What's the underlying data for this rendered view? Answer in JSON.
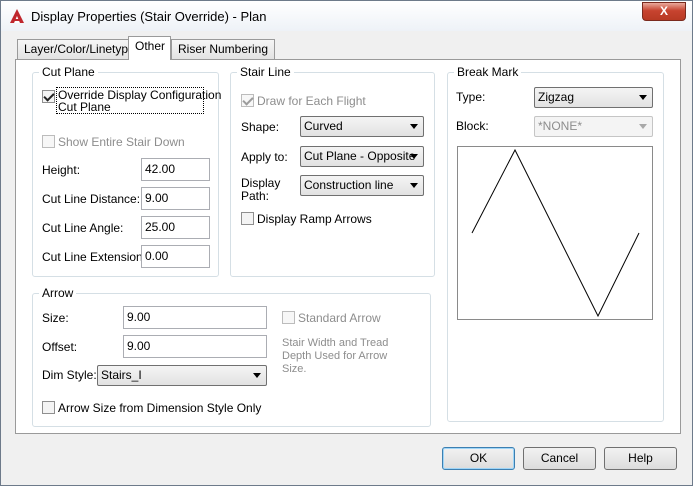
{
  "window": {
    "title": "Display Properties (Stair Override) - Plan",
    "close_glyph": "X"
  },
  "tabs": [
    {
      "label": "Layer/Color/Linetype"
    },
    {
      "label": "Other"
    },
    {
      "label": "Riser Numbering"
    }
  ],
  "cut_plane": {
    "title": "Cut Plane",
    "override_label_line1": "Override Display Configuration",
    "override_label_line2": "Cut Plane",
    "override_checked": true,
    "show_entire_label": "Show Entire Stair Down",
    "height_label": "Height:",
    "height_value": "42.00",
    "cut_line_distance_label": "Cut Line Distance:",
    "cut_line_distance_value": "9.00",
    "cut_line_angle_label": "Cut Line Angle:",
    "cut_line_angle_value": "25.00",
    "cut_line_extension_label": "Cut Line Extension:",
    "cut_line_extension_value": "0.00"
  },
  "stair_line": {
    "title": "Stair Line",
    "draw_each_flight_label": "Draw for Each Flight",
    "shape_label": "Shape:",
    "shape_value": "Curved",
    "apply_to_label": "Apply to:",
    "apply_to_value": "Cut Plane - Opposite",
    "display_path_label_line1": "Display",
    "display_path_label_line2": "Path:",
    "display_path_value": "Construction line",
    "display_ramp_arrows_label": "Display Ramp Arrows"
  },
  "break_mark": {
    "title": "Break Mark",
    "type_label": "Type:",
    "type_value": "Zigzag",
    "block_label": "Block:",
    "block_value": "*NONE*"
  },
  "arrow": {
    "title": "Arrow",
    "size_label": "Size:",
    "size_value": "9.00",
    "offset_label": "Offset:",
    "offset_value": "9.00",
    "dim_style_label": "Dim Style:",
    "dim_style_value": "Stairs_I",
    "standard_arrow_label": "Standard Arrow",
    "description_line1": "Stair Width and Tread",
    "description_line2": "Depth Used for Arrow",
    "description_line3": "Size.",
    "arrow_size_dim_label": "Arrow Size from Dimension Style Only"
  },
  "buttons": {
    "ok": "OK",
    "cancel": "Cancel",
    "help": "Help"
  }
}
